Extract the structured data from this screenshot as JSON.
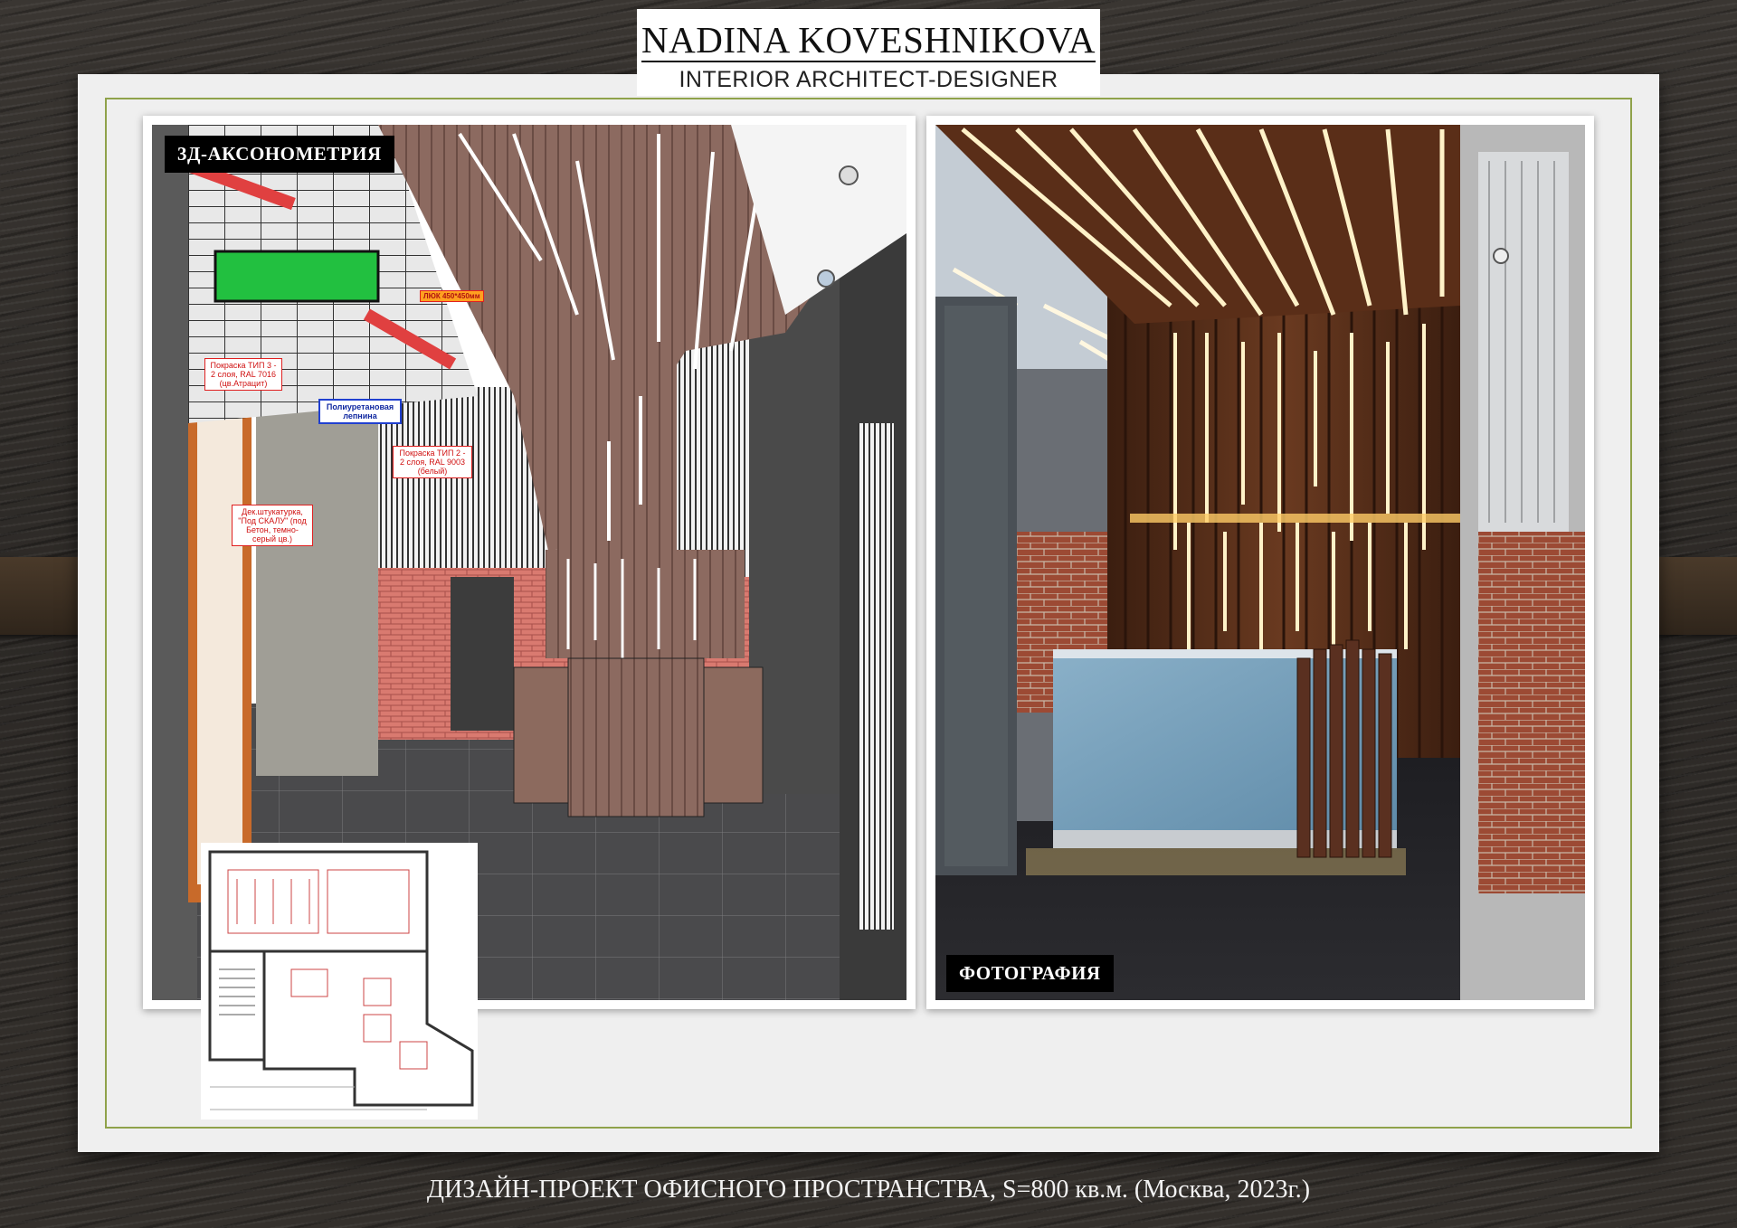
{
  "header": {
    "name": "NADINA KOVESHNIKOVA",
    "role": "INTERIOR ARCHITECT-DESIGNER"
  },
  "panels": {
    "left_label": "3Д-АКСОНОМЕТРИЯ",
    "right_label": "ФОТОГРАФИЯ"
  },
  "annotations": {
    "hatch": "ЛЮК 450*450мм",
    "paint3": "Покраска ТИП 3 - 2 слоя, RAL 7016 (цв.Атрацит)",
    "molding": "Полиуретановая лепнина",
    "paint2": "Покраска ТИП 2 - 2 слоя, RAL 9003 (белый)",
    "plaster": "Дек.штукатурка, \"Под СКАЛУ\" (под Бетон, темно-серый цв.)"
  },
  "caption": "ДИЗАЙН-ПРОЕКТ ОФИСНОГО ПРОСТРАНСТВА, S=800 кв.м. (Москва, 2023г.)",
  "colors": {
    "frame_accent": "#8fa24a",
    "board": "#efefef",
    "label_bg": "#000000"
  }
}
